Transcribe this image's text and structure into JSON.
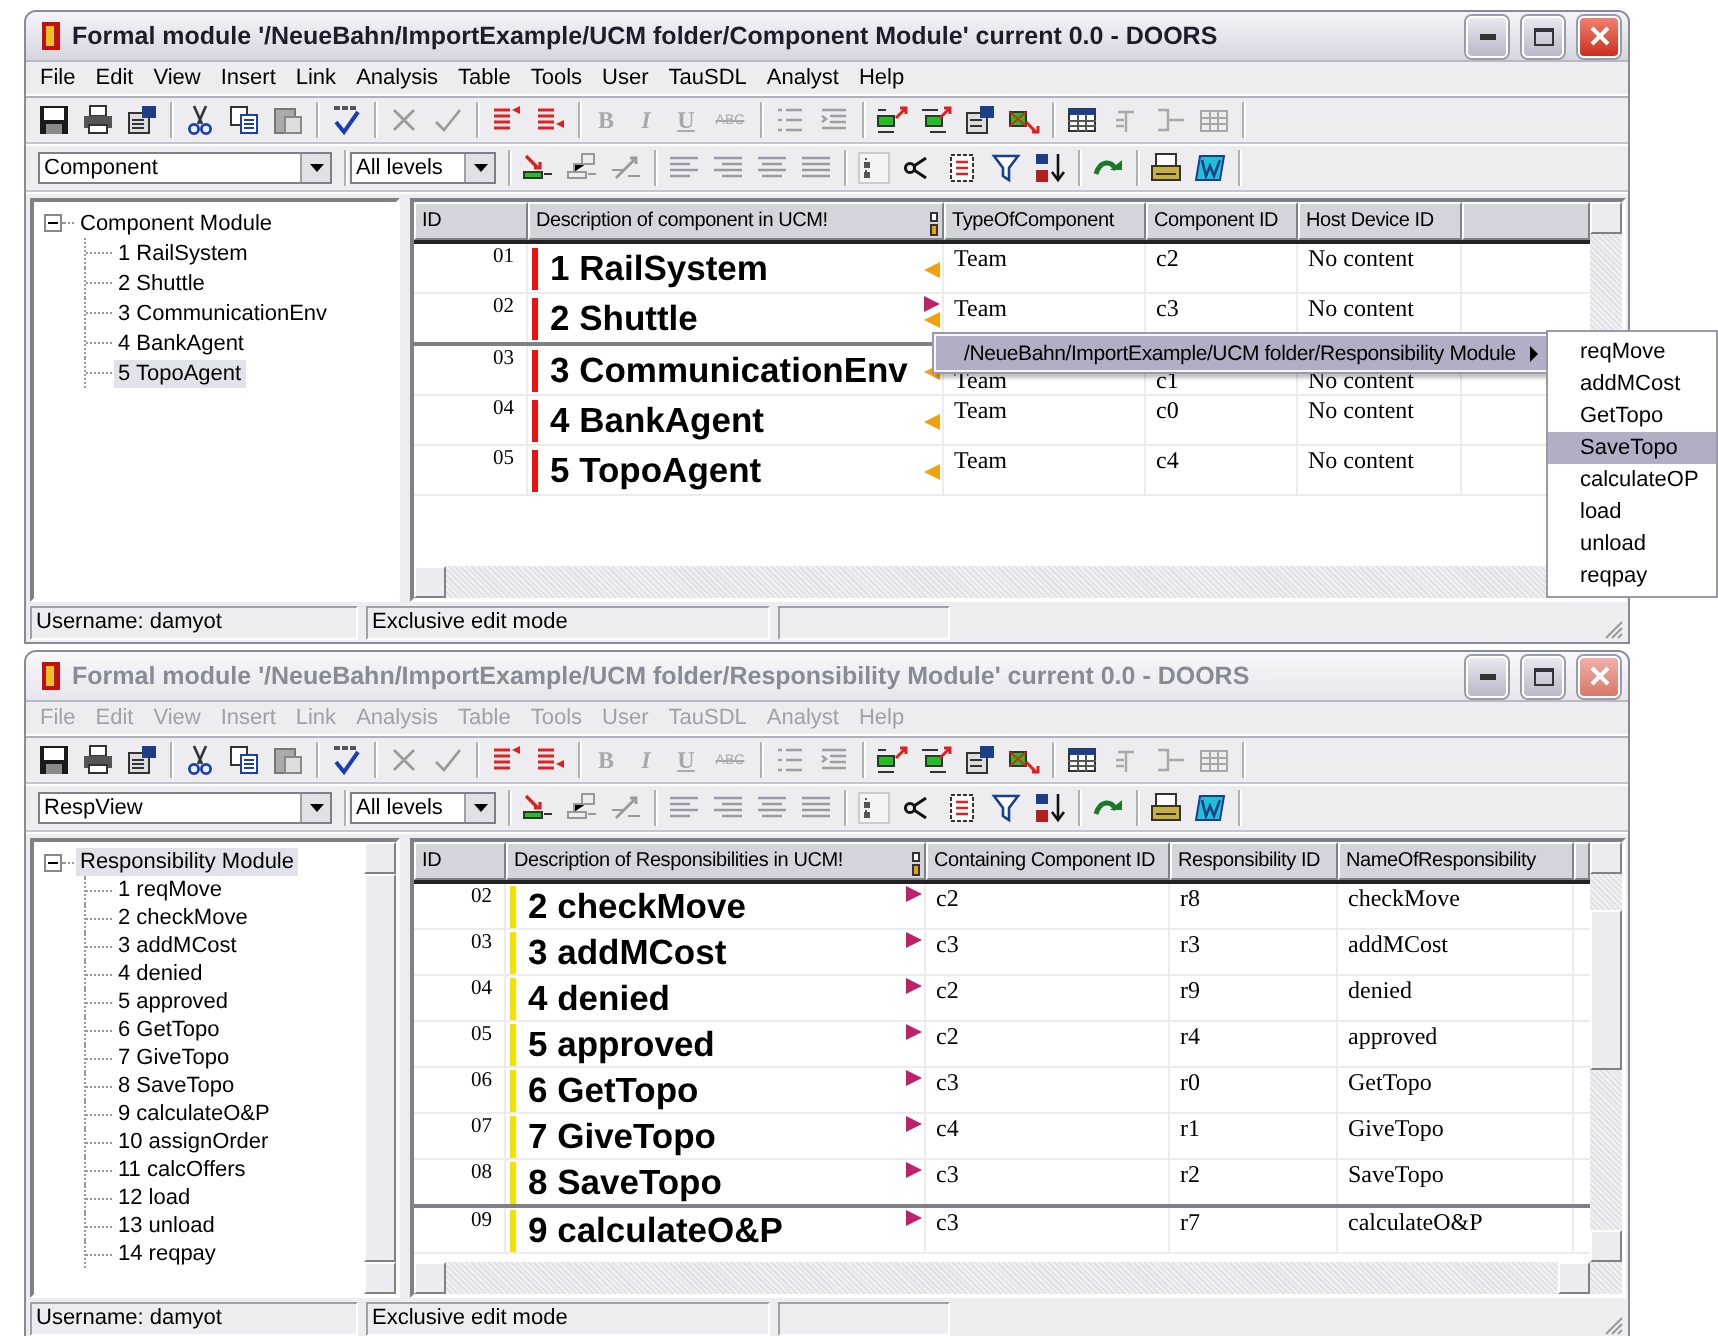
{
  "windows": [
    {
      "title": "Formal module '/NeueBahn/ImportExample/UCM folder/Component Module' current 0.0 - DOORS",
      "active": true,
      "menu": [
        "File",
        "Edit",
        "View",
        "Insert",
        "Link",
        "Analysis",
        "Table",
        "Tools",
        "User",
        "TauSDL",
        "Analyst",
        "Help"
      ],
      "format_buttons": [
        {
          "label": "B",
          "disabled": true
        },
        {
          "label": "I",
          "disabled": true
        },
        {
          "label": "U",
          "disabled": true
        },
        {
          "label": "ABC",
          "disabled": true
        }
      ],
      "view_dropdown": "Component",
      "level_dropdown": "All levels",
      "tree": {
        "label": "Component Module",
        "expanded": true,
        "selected": false,
        "children": [
          {
            "label": "1 RailSystem",
            "selected": false
          },
          {
            "label": "2 Shuttle",
            "selected": false
          },
          {
            "label": "3 CommunicationEnv",
            "selected": false
          },
          {
            "label": "4 BankAgent",
            "selected": false
          },
          {
            "label": "5 TopoAgent",
            "selected": true
          }
        ]
      },
      "table": {
        "columns": [
          "ID",
          "Description of component in UCM!",
          "TypeOfComponent",
          "Component ID",
          "Host Device ID"
        ],
        "rows": [
          {
            "current": false,
            "in_link": true,
            "out_link": false,
            "cells": [
              "01",
              "1 RailSystem",
              "Team",
              "c2",
              "No content"
            ]
          },
          {
            "current": true,
            "in_link": true,
            "out_link": true,
            "cells": [
              "02",
              "2 Shuttle",
              "Team",
              "c3",
              "No content"
            ]
          },
          {
            "current": false,
            "in_link": true,
            "out_link": false,
            "cells": [
              "03",
              "3 CommunicationEnv",
              "Team",
              "c1",
              "No content"
            ]
          },
          {
            "current": false,
            "in_link": true,
            "out_link": false,
            "cells": [
              "04",
              "4 BankAgent",
              "Team",
              "c0",
              "No content"
            ]
          },
          {
            "current": false,
            "in_link": true,
            "out_link": false,
            "cells": [
              "05",
              "5 TopoAgent",
              "Team",
              "c4",
              "No content"
            ]
          }
        ]
      },
      "status_bar": [
        "Username: damyot",
        "Exclusive edit mode"
      ]
    },
    {
      "title": "Formal module '/NeueBahn/ImportExample/UCM folder/Responsibility Module' current 0.0 - DOORS",
      "active": false,
      "menu": [
        "File",
        "Edit",
        "View",
        "Insert",
        "Link",
        "Analysis",
        "Table",
        "Tools",
        "User",
        "TauSDL",
        "Analyst",
        "Help"
      ],
      "format_buttons": [
        {
          "label": "B",
          "disabled": true
        },
        {
          "label": "I",
          "disabled": true
        },
        {
          "label": "U",
          "disabled": true
        },
        {
          "label": "ABC",
          "disabled": true
        }
      ],
      "view_dropdown": "RespView",
      "level_dropdown": "All levels",
      "tree": {
        "label": "Responsibility Module",
        "expanded": true,
        "selected": true,
        "children": [
          {
            "label": "1 reqMove",
            "selected": false
          },
          {
            "label": "2 checkMove",
            "selected": false
          },
          {
            "label": "3 addMCost",
            "selected": false
          },
          {
            "label": "4 denied",
            "selected": false
          },
          {
            "label": "5 approved",
            "selected": false
          },
          {
            "label": "6 GetTopo",
            "selected": false
          },
          {
            "label": "7 GiveTopo",
            "selected": false
          },
          {
            "label": "8 SaveTopo",
            "selected": false
          },
          {
            "label": "9 calculateO&P",
            "selected": false
          },
          {
            "label": "10 assignOrder",
            "selected": false
          },
          {
            "label": "11 calcOffers",
            "selected": false
          },
          {
            "label": "12 load",
            "selected": false
          },
          {
            "label": "13 unload",
            "selected": false
          },
          {
            "label": "14 reqpay",
            "selected": false
          }
        ]
      },
      "table": {
        "columns": [
          "ID",
          "Description of Responsibilities in UCM!",
          "Containing Component ID",
          "Responsibility ID",
          "NameOfResponsibility"
        ],
        "rows": [
          {
            "current": false,
            "in_link": false,
            "out_link": true,
            "cells": [
              "02",
              "2 checkMove",
              "c2",
              "r8",
              "checkMove"
            ]
          },
          {
            "current": false,
            "in_link": false,
            "out_link": true,
            "cells": [
              "03",
              "3 addMCost",
              "c3",
              "r3",
              "addMCost"
            ]
          },
          {
            "current": false,
            "in_link": false,
            "out_link": true,
            "cells": [
              "04",
              "4 denied",
              "c2",
              "r9",
              "denied"
            ]
          },
          {
            "current": false,
            "in_link": false,
            "out_link": true,
            "cells": [
              "05",
              "5 approved",
              "c2",
              "r4",
              "approved"
            ]
          },
          {
            "current": false,
            "in_link": false,
            "out_link": true,
            "cells": [
              "06",
              "6 GetTopo",
              "c3",
              "r0",
              "GetTopo"
            ]
          },
          {
            "current": false,
            "in_link": false,
            "out_link": true,
            "cells": [
              "07",
              "7 GiveTopo",
              "c4",
              "r1",
              "GiveTopo"
            ]
          },
          {
            "current": true,
            "in_link": false,
            "out_link": true,
            "cells": [
              "08",
              "8 SaveTopo",
              "c3",
              "r2",
              "SaveTopo"
            ]
          },
          {
            "current": false,
            "in_link": false,
            "out_link": true,
            "cells": [
              "09",
              "9 calculateO&P",
              "c3",
              "r7",
              "calculateO&P"
            ]
          }
        ]
      },
      "status_bar": [
        "Username: damyot",
        "Exclusive edit mode"
      ]
    }
  ],
  "context_menu": {
    "items": [
      {
        "label": "/NeueBahn/ImportExample/UCM folder/Responsibility Module",
        "selected": true,
        "submenu": true
      }
    ],
    "submenu": [
      {
        "label": "reqMove",
        "selected": false
      },
      {
        "label": "addMCost",
        "selected": false
      },
      {
        "label": "GetTopo",
        "selected": false
      },
      {
        "label": "SaveTopo",
        "selected": true
      },
      {
        "label": "calculateOP",
        "selected": false
      },
      {
        "label": "load",
        "selected": false
      },
      {
        "label": "unload",
        "selected": false
      },
      {
        "label": "reqpay",
        "selected": false
      }
    ]
  }
}
